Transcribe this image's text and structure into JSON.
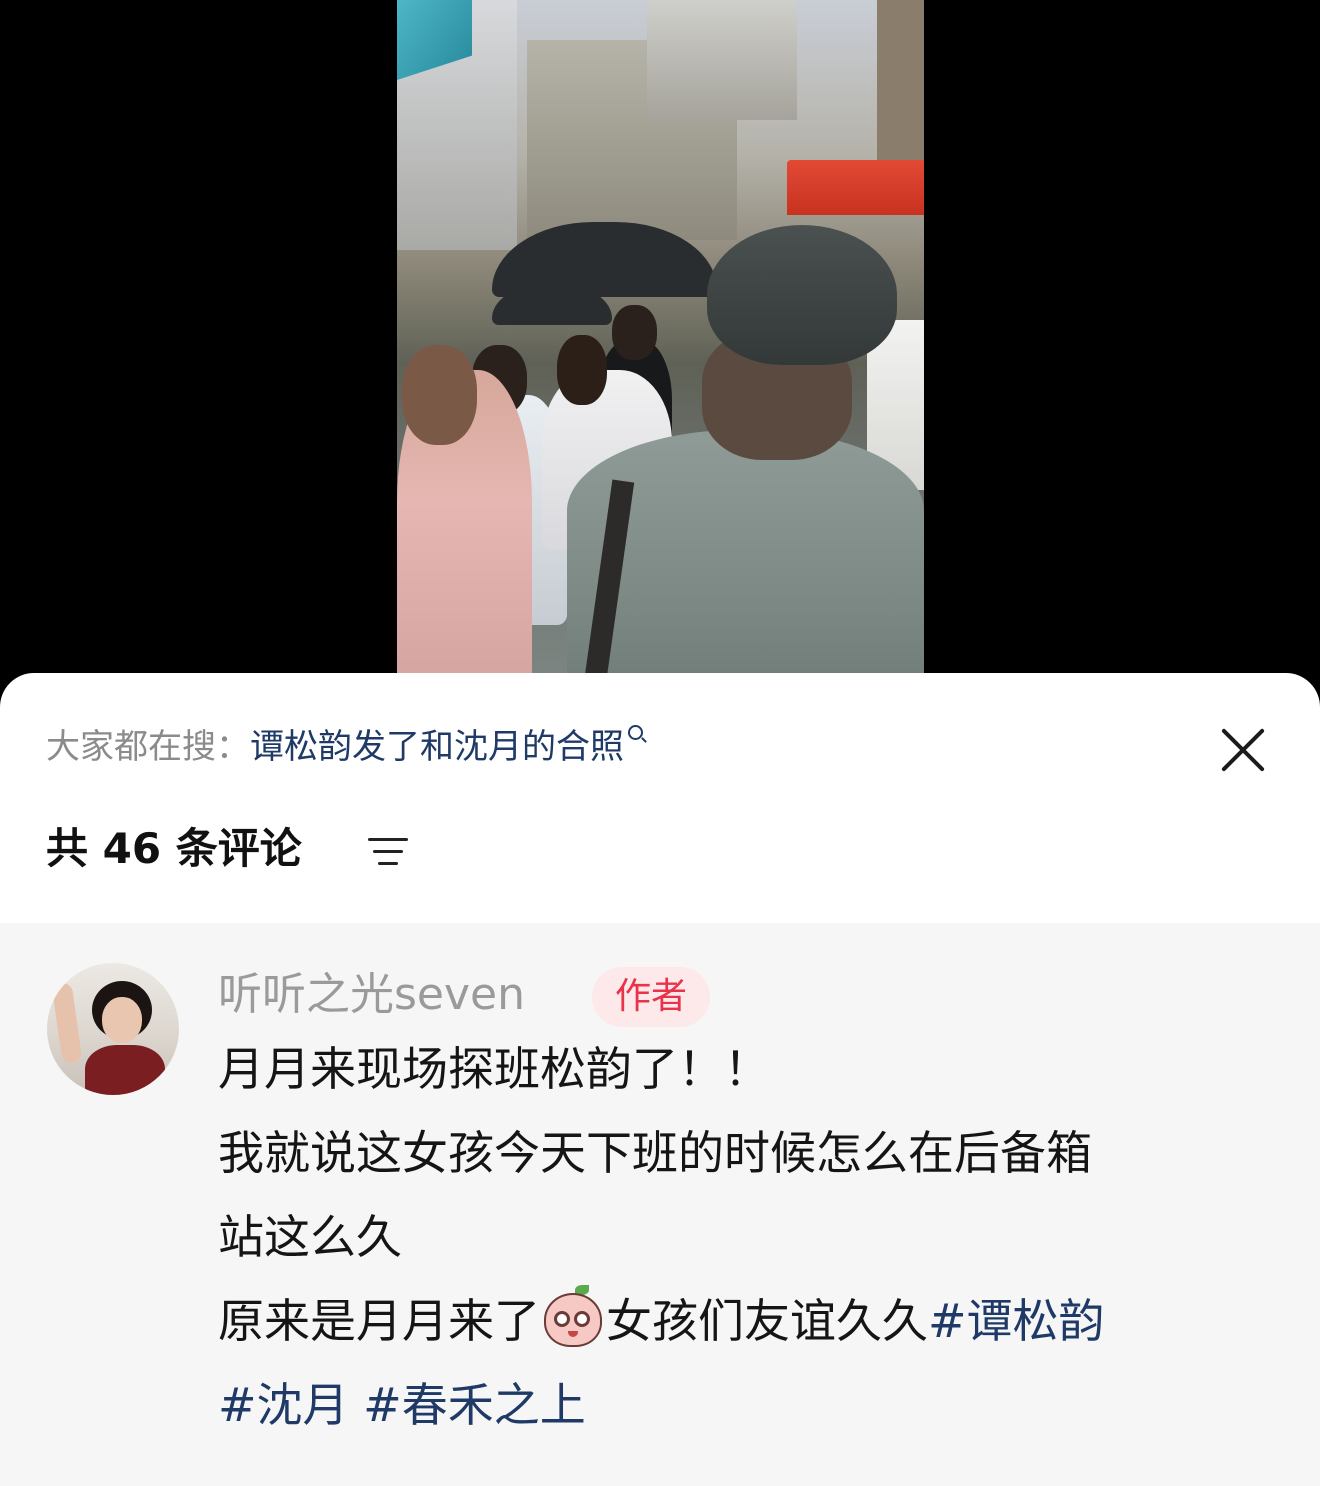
{
  "search_hint": {
    "prefix": "大家都在搜：",
    "query": "谭松韵发了和沈月的合照"
  },
  "comments_header": {
    "count_label": "共 46 条评论"
  },
  "comment": {
    "username": "听听之光seven",
    "badge": "作者",
    "lines": [
      "月月来现场探班松韵了！！",
      "我就说这女孩今天下班的时候怎么在后备箱",
      "站这么久"
    ],
    "line4_text_before_emoji": "原来是月月来了",
    "line4_text_after_emoji": "女孩们友谊久久",
    "hashtags": [
      "#谭松韵",
      "#沈月",
      "#春禾之上"
    ]
  },
  "colors": {
    "link_blue": "#1f3a66",
    "badge_red": "#e8334a",
    "badge_bg": "#fde8ea",
    "comment_bg": "#f6f6f6"
  },
  "icons": [
    "search-icon",
    "close-icon",
    "sort-icon",
    "emoji-icon"
  ]
}
